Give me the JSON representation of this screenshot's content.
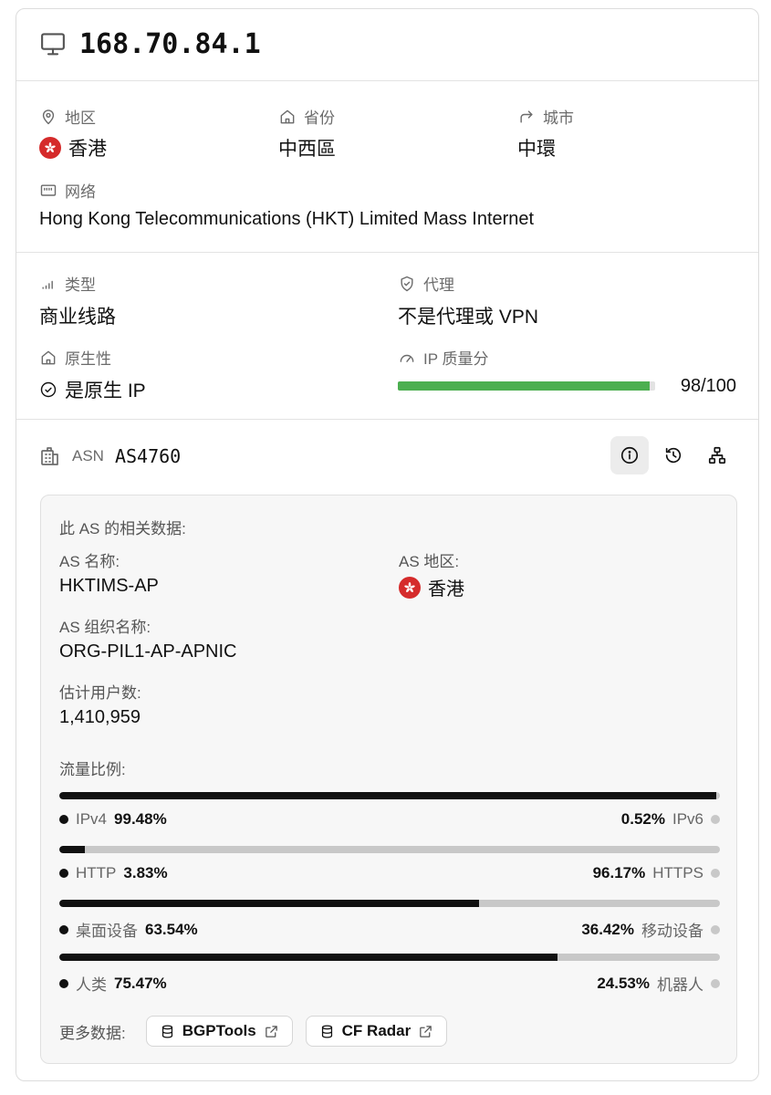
{
  "ip": "168.70.84.1",
  "location": {
    "region_label": "地区",
    "region_value": "香港",
    "province_label": "省份",
    "province_value": "中西區",
    "city_label": "城市",
    "city_value": "中環",
    "network_label": "网络",
    "network_value": "Hong Kong Telecommunications (HKT) Limited Mass Internet"
  },
  "details": {
    "type_label": "类型",
    "type_value": "商业线路",
    "proxy_label": "代理",
    "proxy_value": "不是代理或 VPN",
    "native_label": "原生性",
    "native_value": "是原生 IP",
    "quality_label": "IP 质量分",
    "quality_value": "98/100",
    "quality_score": 98,
    "quality_color": "#4caf50"
  },
  "asn": {
    "label": "ASN",
    "value": "AS4760",
    "panel_title": "此 AS 的相关数据:",
    "name_label": "AS 名称:",
    "name_value": "HKTIMS-AP",
    "region_label": "AS 地区:",
    "region_value": "香港",
    "org_label": "AS 组织名称:",
    "org_value": "ORG-PIL1-AP-APNIC",
    "users_label": "估计用户数:",
    "users_value": "1,410,959",
    "traffic_label": "流量比例:",
    "traffic": [
      {
        "left_name": "IPv4",
        "left_pct": "99.48%",
        "right_pct": "0.52%",
        "right_name": "IPv6",
        "fraction": 0.9948
      },
      {
        "left_name": "HTTP",
        "left_pct": "3.83%",
        "right_pct": "96.17%",
        "right_name": "HTTPS",
        "fraction": 0.0383
      },
      {
        "left_name": "桌面设备",
        "left_pct": "63.54%",
        "right_pct": "36.42%",
        "right_name": "移动设备",
        "fraction": 0.6354
      },
      {
        "left_name": "人类",
        "left_pct": "75.47%",
        "right_pct": "24.53%",
        "right_name": "机器人",
        "fraction": 0.7547
      }
    ],
    "more_label": "更多数据:",
    "links": [
      "BGPTools",
      "CF Radar"
    ]
  },
  "icons": [
    "monitor-icon",
    "map-pin-icon",
    "home-icon",
    "forward-arrow-icon",
    "ethernet-icon",
    "signal-icon",
    "shield-check-icon",
    "gauge-icon",
    "check-circle-icon",
    "building-icon",
    "info-icon",
    "history-icon",
    "network-tree-icon",
    "database-icon",
    "external-link-icon"
  ],
  "flag_color": "#d52b2b"
}
